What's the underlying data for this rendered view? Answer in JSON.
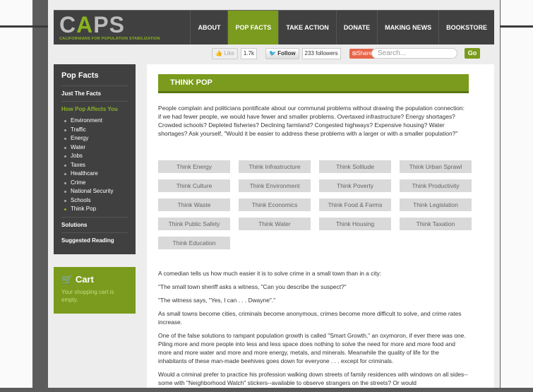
{
  "logo": {
    "text_a": "C",
    "text_accent": "A",
    "text_b": "PS",
    "tagline": "CALIFORNIANS FOR POPULATION STABILIZATION"
  },
  "nav": [
    "ABOUT",
    "POP FACTS",
    "TAKE ACTION",
    "DONATE",
    "MAKING NEWS",
    "BOOKSTORE"
  ],
  "social": {
    "like_label": "Like",
    "like_count": "1.7k",
    "follow_label": "Follow",
    "follow_count": "233 followers",
    "share_label": "Share"
  },
  "search": {
    "placeholder": "Search...",
    "go_label": "Go"
  },
  "sidebar": {
    "title": "Pop Facts",
    "just_the_facts": "Just The Facts",
    "how_pop": "How Pop Affects You",
    "subitems": [
      "Environment",
      "Traffic",
      "Energy",
      "Water",
      "Jobs",
      "Taxes",
      "Healthcare",
      "Crime",
      "National Security",
      "Schools",
      "Think Pop"
    ],
    "solutions": "Solutions",
    "suggested": "Suggested Reading"
  },
  "cart": {
    "title": "Cart",
    "text": "Your shopping cart is empty."
  },
  "main": {
    "banner": "THINK POP",
    "intro": "People complain and politicians pontificate about our communal problems without drawing the population connection: if we had fewer people, we would have fewer and smaller problems. Overtaxed infrastructure? Energy shortages? Crowded schools? Depleted fisheries? Declining farmland? Congested highways? Expensive housing? Water shortages? Ask yourself, \"Would it be easier to address these problems with a larger or with a smaller population?\"",
    "buttons": [
      "Think Energy",
      "Think Infrastructure",
      "Think Solitude",
      "Think Urban Sprawl",
      "Think Culture",
      "Think Environment",
      "Think Poverty",
      "Think Productivity",
      "Think Waste",
      "Think Economics",
      "Think Food & Farms",
      "Think Legislation",
      "Think Public Safety",
      "Think Water",
      "Think Housing",
      "Think Taxation",
      "Think Education"
    ],
    "paragraphs": [
      "A comedian tells us how much easier it is to solve crime in a small town than in a city:",
      "\"The small town sheriff asks a witness, \"Can you describe the suspect?\"",
      "\"The witness says, \"Yes, I can . . . Dwayne\".\"",
      "As small towns become cities, criminals become anonymous, crimes become more difficult to solve, and crime rates increase.",
      "One of the false solutions to rampant population growth is called \"Smart Growth,\" an oxymoron, if ever there was one. Piling more and more people into less and less space does nothing to solve the need for more and more food and more and more water and more and more energy, metals, and minerals. Meanwhile the quality of life for the inhabitants of these man-made beehives goes down for everyone . . . except for criminals.",
      "Would a criminal prefer to practice his profession walking down streets of family residences with windows on all sides--some with \"Neighborhood Watch\" stickers--available to observe strangers on the streets? Or would"
    ]
  }
}
